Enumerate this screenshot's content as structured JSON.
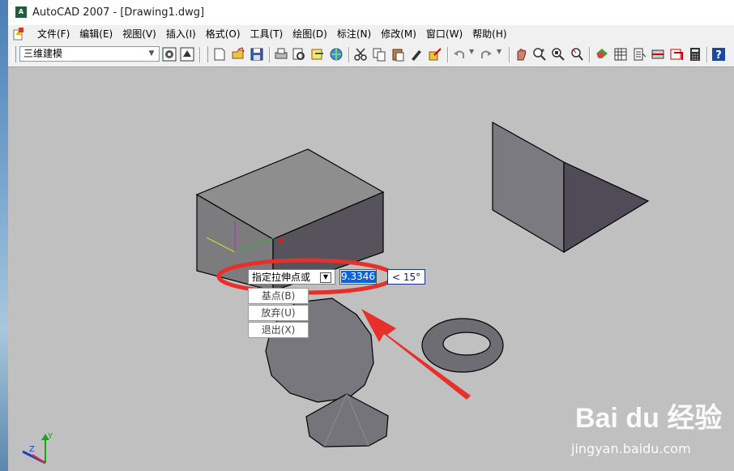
{
  "window": {
    "title": "AutoCAD 2007 - [Drawing1.dwg]",
    "icon_label": "A"
  },
  "menu": [
    "文件(F)",
    "编辑(E)",
    "视图(V)",
    "插入(I)",
    "格式(O)",
    "工具(T)",
    "绘图(D)",
    "标注(N)",
    "修改(M)",
    "窗口(W)",
    "帮助(H)"
  ],
  "toolbar": {
    "workspace": "三维建模",
    "icons": [
      "workspace-settings-icon",
      "workspace-save-icon",
      "new-icon",
      "open-icon",
      "save-icon",
      "plot-icon",
      "plot-preview-icon",
      "publish-icon",
      "3d-dwf-icon",
      "cut-icon",
      "copy-icon",
      "paste-icon",
      "match-properties-icon",
      "block-editor-icon",
      "undo-icon",
      "redo-icon",
      "pan-icon",
      "zoom-realtime-icon",
      "zoom-window-icon",
      "zoom-previous-icon",
      "properties-icon",
      "design-center-icon",
      "tool-palettes-icon",
      "sheet-set-icon",
      "markup-icon",
      "calculator-icon",
      "help-icon"
    ]
  },
  "dynamic_input": {
    "prompt": "指定拉伸点或",
    "value": "9.3346",
    "angle": "< 15°",
    "options": [
      "基点(B)",
      "放弃(U)",
      "退出(X)"
    ]
  },
  "ucs": {
    "y": "Y",
    "z": "Z"
  },
  "watermark": {
    "logo": "Bai du 经验",
    "url": "jingyan.baidu.com"
  },
  "colors": {
    "background": "#c0c0c0",
    "annotation": "#e8302a",
    "selection": "#0a64d6"
  }
}
